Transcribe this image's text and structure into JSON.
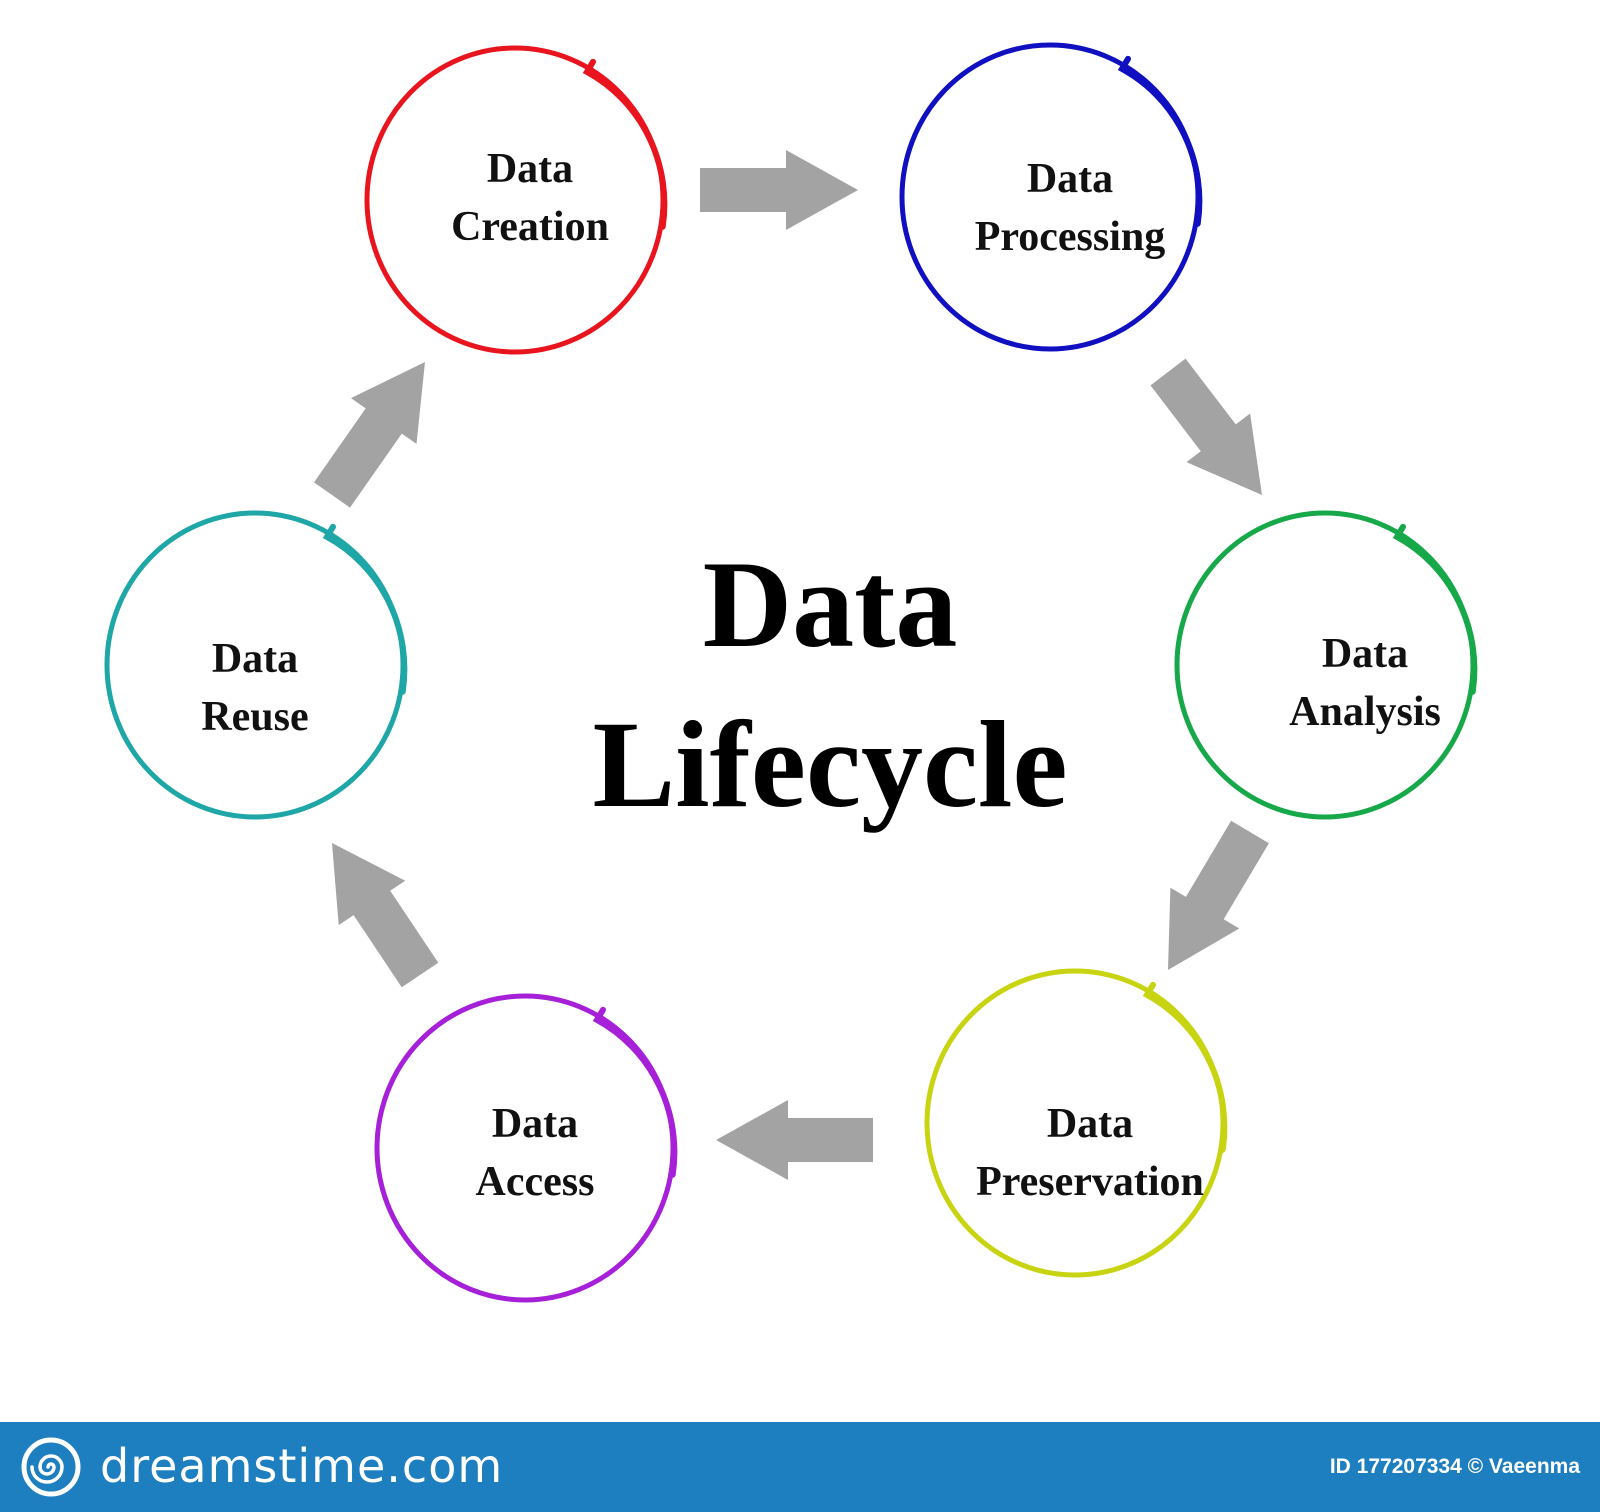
{
  "diagram": {
    "title_line1": "Data",
    "title_line2": "Lifecycle",
    "nodes": [
      {
        "line1": "Data",
        "line2": "Creation",
        "color": "#e8151f"
      },
      {
        "line1": "Data",
        "line2": "Processing",
        "color": "#1010c0"
      },
      {
        "line1": "Data",
        "line2": "Analysis",
        "color": "#17a84a"
      },
      {
        "line1": "Data",
        "line2": "Preservation",
        "color": "#c8d411"
      },
      {
        "line1": "Data",
        "line2": "Access",
        "color": "#a620d8"
      },
      {
        "line1": "Data",
        "line2": "Reuse",
        "color": "#1fa6a6"
      }
    ],
    "arrow_color": "#a3a3a3"
  },
  "footer": {
    "brand": "dreamstime.com",
    "credit": "ID 177207334 © Vaeenma",
    "background": "#1d7fbf"
  }
}
